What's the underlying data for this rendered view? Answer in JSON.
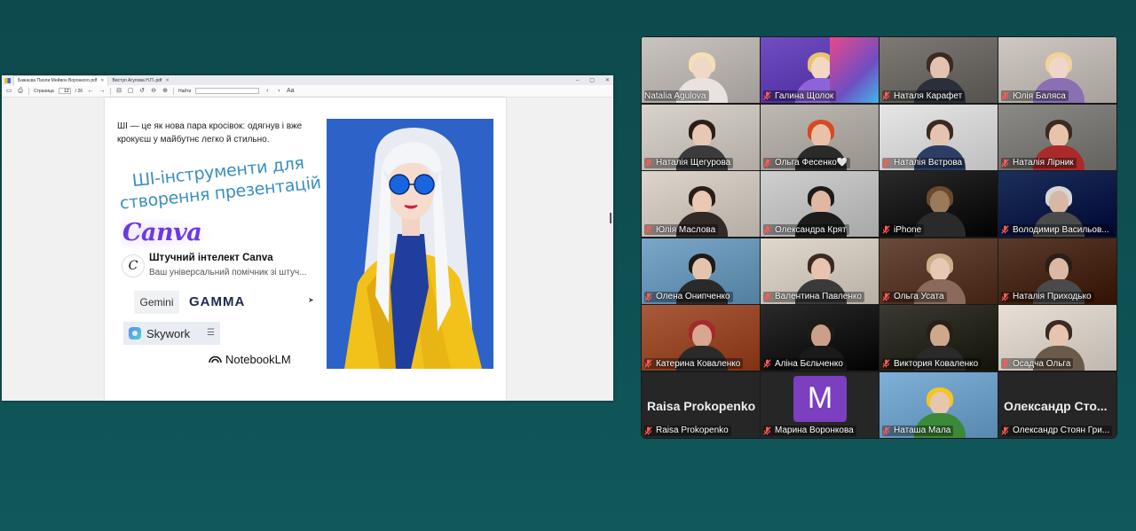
{
  "pdf_viewer": {
    "tabs": [
      {
        "label": "Бажаєва Паоли Мейвон Воронкого.pdf",
        "active": true
      },
      {
        "label": "Виступ Агулова Н.П..pdf",
        "active": false
      }
    ],
    "toolbar": {
      "page_label": "Страница",
      "current_page": "12",
      "total_pages": "/ 26",
      "search_label": "Найти",
      "search_value": "",
      "text_size_icon": "Aa"
    },
    "page": {
      "intro_text": "ШІ — це як нова пара кросівок: одягнув і вже крокуєш у майбутнє легко й стильно.",
      "heading": "ШІ-інструменти для створення презентацій",
      "canva_logo": "Canva",
      "canva_ai_title": "Штучний інтелект Canva",
      "canva_ai_subtitle": "Ваш універсальний помічник зі штуч...",
      "gemini": "Gemini",
      "gamma": "GAMMA",
      "skywork": "Skywork",
      "notebooklm": "NotebookLM"
    }
  },
  "call": {
    "tiles": [
      {
        "name": "Natalia Agulova",
        "muted": false,
        "active": true
      },
      {
        "name": "Галина Щолок",
        "muted": true
      },
      {
        "name": "Наталя Карафет",
        "muted": true
      },
      {
        "name": "Юлія Баляса",
        "muted": true
      },
      {
        "name": "Наталія Щегурова",
        "muted": true
      },
      {
        "name": "Ольга Фесенко🤍",
        "muted": true
      },
      {
        "name": "Наталія Вєтрова",
        "muted": true
      },
      {
        "name": "Наталія Лірник",
        "muted": true
      },
      {
        "name": "Юлія Маслова",
        "muted": true
      },
      {
        "name": "Олександра Крят",
        "muted": true
      },
      {
        "name": "iPhone",
        "muted": true
      },
      {
        "name": "Володимир Васильов...",
        "muted": true
      },
      {
        "name": "Олена Онипченко",
        "muted": true
      },
      {
        "name": "Валентина Павленко",
        "muted": true
      },
      {
        "name": "Ольга Усата",
        "muted": true
      },
      {
        "name": "Наталія Приходько",
        "muted": true
      },
      {
        "name": "Катерина Коваленко",
        "muted": true
      },
      {
        "name": "Аліна Бєльченко",
        "muted": true
      },
      {
        "name": "Виктория Коваленко",
        "muted": true
      },
      {
        "name": "Осадча Ольга",
        "muted": true
      },
      {
        "name": "Raisa Prokopenko",
        "muted": true,
        "video_off": true,
        "display": "Raisa Prokopenko"
      },
      {
        "name": "Марина Воронкова",
        "muted": true,
        "video_off": true,
        "avatar": "M"
      },
      {
        "name": "Наташа Мала",
        "muted": true
      },
      {
        "name": "Олександр Стоян Гри...",
        "muted": true,
        "video_off": true,
        "display": "Олександр Сто..."
      }
    ]
  },
  "colors": {
    "background": "#0e4f52",
    "active_speaker": "#3fd47a",
    "mic_off": "#e53935",
    "avatar_purple": "#7b3fbf",
    "slide_heading": "#3b8fc0",
    "canva_purple": "#6a3ae0"
  }
}
